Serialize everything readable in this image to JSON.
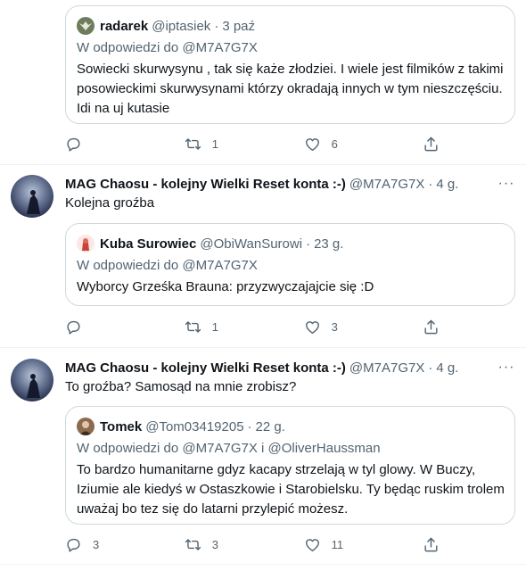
{
  "tweets": [
    {
      "quote": {
        "name": "radarek",
        "handle": "@iptasiek",
        "sep": "·",
        "time": "3 paź",
        "reply_prefix": "W odpowiedzi do",
        "reply_to": "@M7A7G7X",
        "text_lines": [
          "Sowiecki skurwysynu , tak się każe złodziei. I wiele jest filmików z takimi",
          "posowieckimi skurwysynami którzy okradają innych w tym nieszczęściu.",
          "Idi na uj kutasie"
        ]
      },
      "actions": {
        "reply": "",
        "retweet": "1",
        "like": "6"
      }
    },
    {
      "author_name": "MAG Chaosu - kolejny Wielki Reset konta :-)",
      "author_handle": "@M7A7G7X",
      "sep": "·",
      "time": "4 g.",
      "more": "···",
      "text": "Kolejna groźba",
      "quote": {
        "name": "Kuba Surowiec",
        "handle": "@ObiWanSurowi",
        "sep": "·",
        "time": "23 g.",
        "reply_prefix": "W odpowiedzi do",
        "reply_to": "@M7A7G7X",
        "text_lines": [
          "Wyborcy Grześka Brauna: przyzwyczajajcie się :D"
        ]
      },
      "actions": {
        "reply": "",
        "retweet": "1",
        "like": "3"
      }
    },
    {
      "author_name": "MAG Chaosu - kolejny Wielki Reset konta :-)",
      "author_handle": "@M7A7G7X",
      "sep": "·",
      "time": "4 g.",
      "more": "···",
      "text": "To groźba? Samosąd na mnie zrobisz?",
      "quote": {
        "name": "Tomek",
        "handle": "@Tom03419205",
        "sep": "·",
        "time": "22 g.",
        "reply_prefix": "W odpowiedzi do",
        "reply_to": "@M7A7G7X i @OliverHaussman",
        "text_lines": [
          "To bardzo humanitarne gdyz kacapy strzelają w tyl glowy. W Buczy,",
          "Iziumie ale kiedyś w Ostaszkowie i Starobielsku. Ty będąc ruskim trolem",
          "uważaj bo tez się do latarni przylepić możesz."
        ]
      },
      "actions": {
        "reply": "3",
        "retweet": "3",
        "like": "11"
      }
    }
  ],
  "icons": {
    "reply": "reply-icon",
    "retweet": "retweet-icon",
    "like": "heart-icon",
    "share": "share-icon"
  }
}
